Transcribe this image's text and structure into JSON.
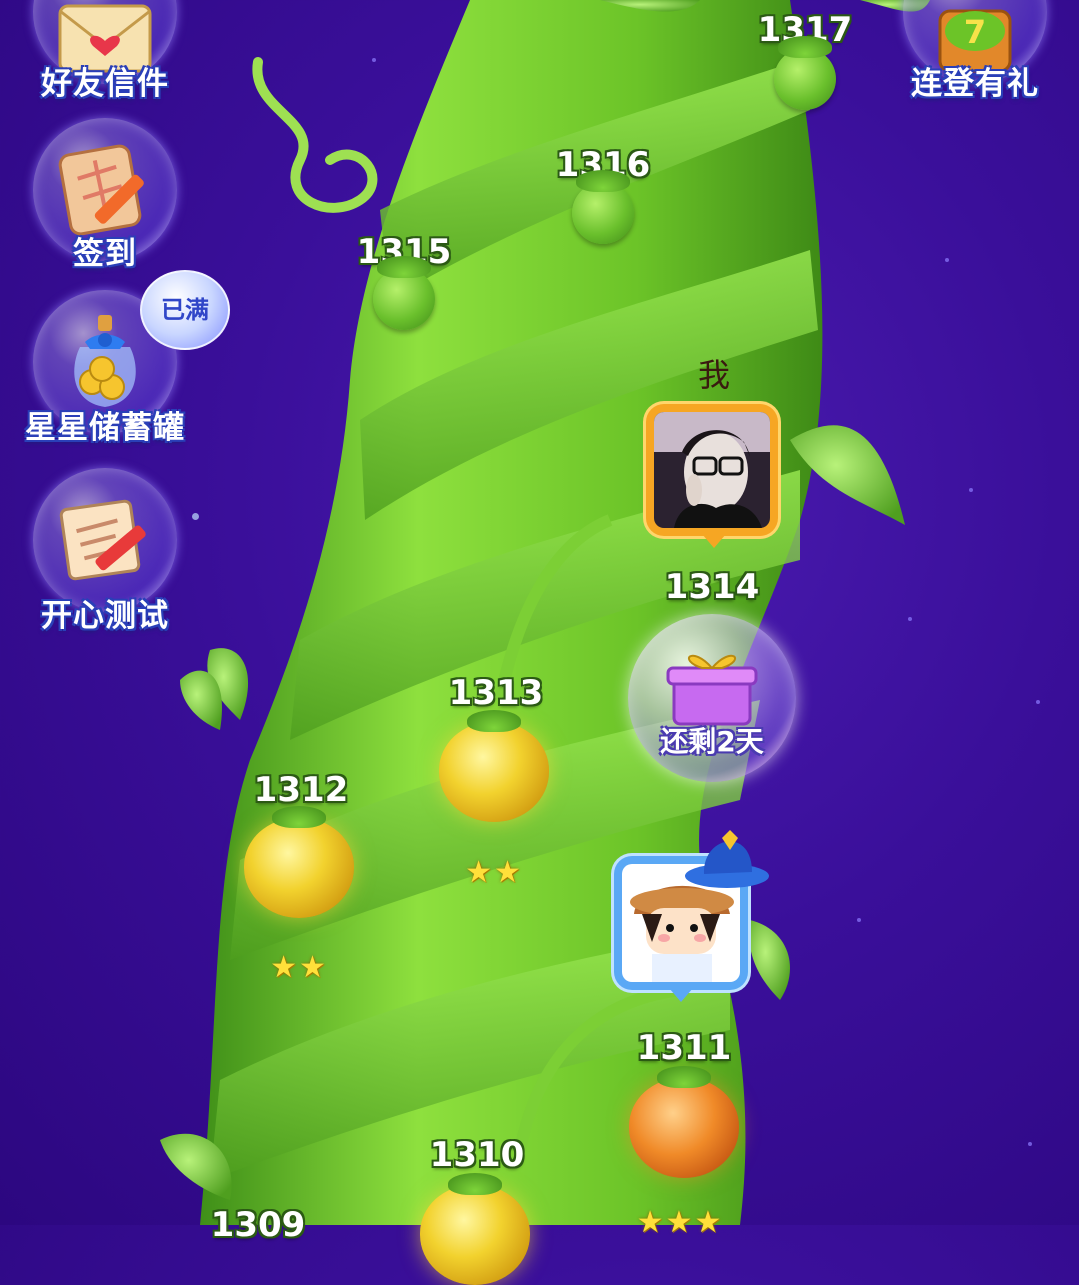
{
  "menu": {
    "friend_mail": {
      "label": "好友信件",
      "icon": "envelope-heart-icon"
    },
    "checkin": {
      "label": "签到",
      "icon": "calendar-pencil-icon"
    },
    "star_jar": {
      "label": "星星储蓄罐",
      "icon": "coin-jar-icon",
      "badge": "已满"
    },
    "happy_test": {
      "label": "开心测试",
      "icon": "scroll-pencil-icon"
    },
    "login_gift": {
      "label": "连登有礼",
      "icon": "gift-box-icon"
    }
  },
  "levels": [
    {
      "number": "1317",
      "pod": "green",
      "stars": ""
    },
    {
      "number": "1316",
      "pod": "green",
      "stars": ""
    },
    {
      "number": "1315",
      "pod": "green",
      "stars": ""
    },
    {
      "number": "1314",
      "pod": "gift",
      "stars": ""
    },
    {
      "number": "1313",
      "pod": "gold",
      "stars": "★★"
    },
    {
      "number": "1312",
      "pod": "gold",
      "stars": "★★"
    },
    {
      "number": "1311",
      "pod": "orange",
      "stars": "★★★"
    },
    {
      "number": "1310",
      "pod": "gold",
      "stars": ""
    },
    {
      "number": "1309",
      "pod": "gold",
      "stars": ""
    }
  ],
  "player": {
    "label": "我",
    "avatar": "player-avatar"
  },
  "friend": {
    "avatar": "friend-avatar-maruko"
  },
  "gift": {
    "text": "还剩2天"
  },
  "colors": {
    "background": "#3a0f9a",
    "stalk": "#6cc428",
    "label_outline": "#2b5a14"
  }
}
